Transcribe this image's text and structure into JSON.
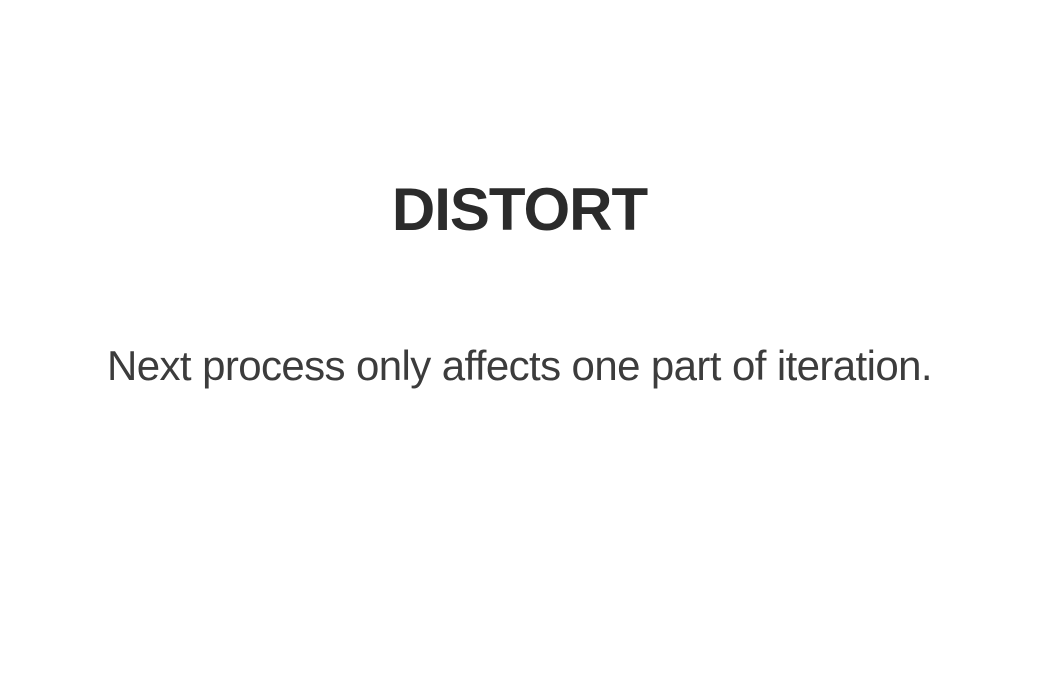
{
  "slide": {
    "title": "DISTORT",
    "subtitle": "Next process only affects one part of iteration."
  }
}
